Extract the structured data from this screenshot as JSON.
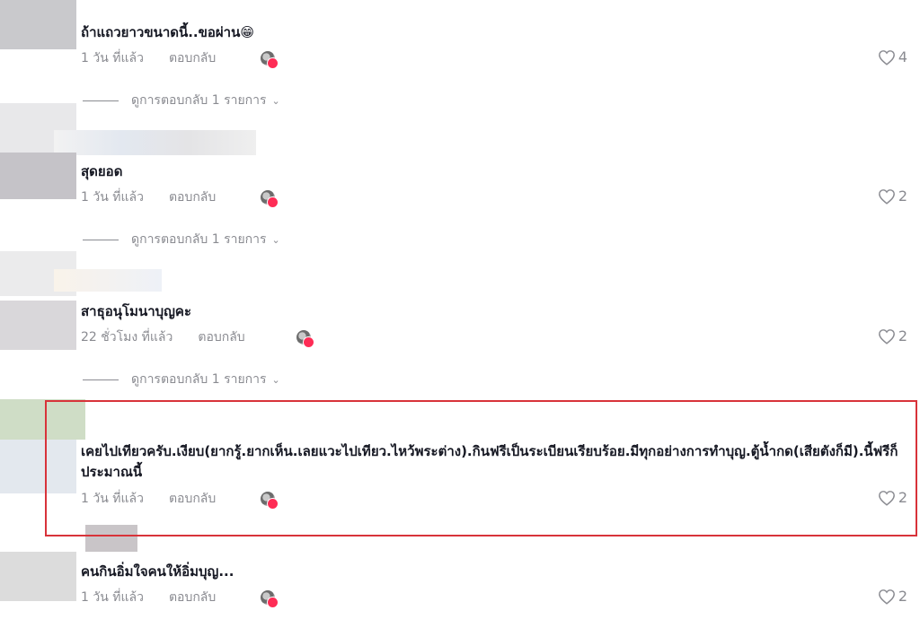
{
  "comments": [
    {
      "text": "ถ้าแถวยาวขนาดนี้..ขอผ่าน😁",
      "time": "1 วัน ที่แล้ว",
      "reply": "ตอบกลับ",
      "likes": "4",
      "view_replies": "ดูการตอบกลับ 1 รายการ"
    },
    {
      "text": "สุดยอด",
      "time": "1 วัน ที่แล้ว",
      "reply": "ตอบกลับ",
      "likes": "2",
      "view_replies": "ดูการตอบกลับ 1 รายการ"
    },
    {
      "text": "สาธุอนุโมนาบุญคะ",
      "time": "22 ชั่วโมง ที่แล้ว",
      "reply": "ตอบกลับ",
      "likes": "2",
      "view_replies": "ดูการตอบกลับ 1 รายการ"
    },
    {
      "text": "เคยไปเทียวครับ.เงียบ(ยากรู้.ยากเห็น.เลยแวะไปเทียว.ไหว้พระต่าง).กินฟรีเป็นระเบียนเรียบร้อย.มีทุกอย่างการทำบุญ.ตู้น้ำกด(เสียตังก็มี).นี้ฟรีก็ประมาณนี้",
      "time": "1 วัน ที่แล้ว",
      "reply": "ตอบกลับ",
      "likes": "2"
    },
    {
      "text": "คนกินอิ่มใจคนให้อิ่มบุญ...",
      "time": "1 วัน ที่แล้ว",
      "reply": "ตอบกลับ",
      "likes": "2"
    }
  ],
  "colors": {
    "highlight": "#d8333a",
    "muted": "#8a8b91",
    "text": "#161823"
  },
  "icons": {
    "like": "heart-outline-icon",
    "expand": "chevron-down-icon"
  }
}
